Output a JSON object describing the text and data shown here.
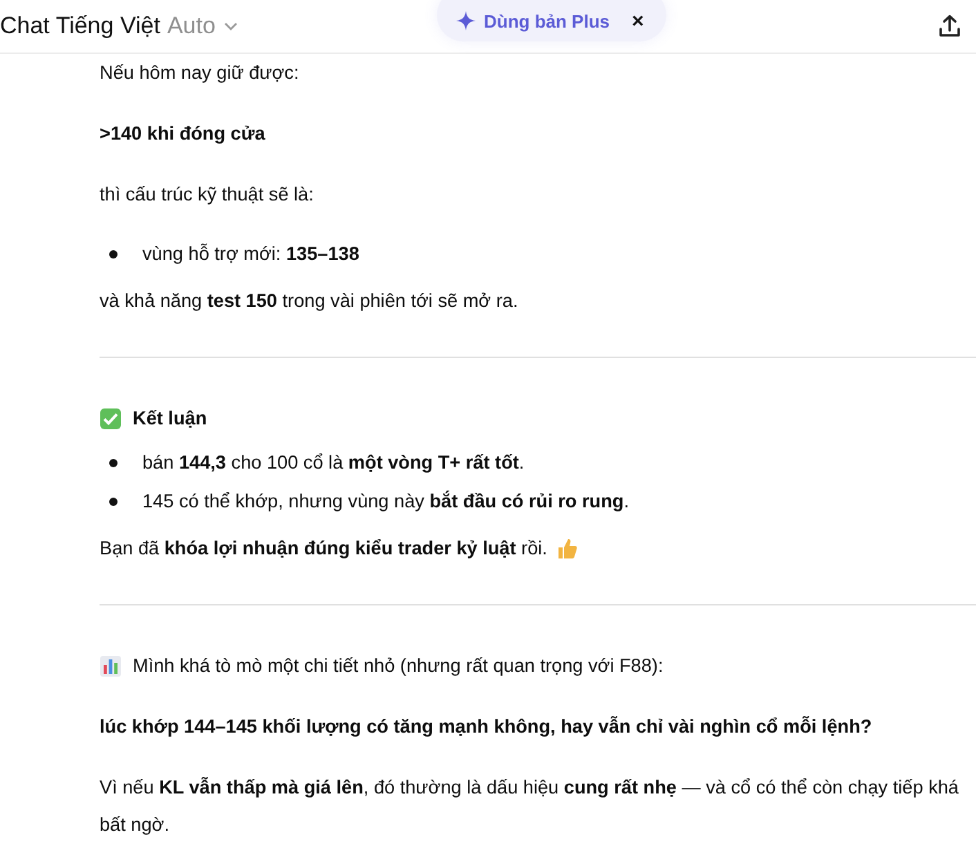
{
  "header": {
    "title": "Chat Tiếng Việt",
    "model": "Auto",
    "upgrade": {
      "label": "Dùng bản Plus",
      "close": "×"
    }
  },
  "blocks": [
    {
      "kind": "paragraph",
      "text": "Nếu hôm nay giữ được:"
    },
    {
      "kind": "paragraph",
      "text": "**>140 khi đóng cửa**"
    },
    {
      "kind": "paragraph",
      "text": "thì cấu trúc kỹ thuật sẽ là:"
    },
    {
      "kind": "list",
      "items": [
        "vùng hỗ trợ mới: **135–138**"
      ]
    },
    {
      "kind": "paragraph",
      "text": "và khả năng **test 150** trong vài phiên tới sẽ mở ra."
    },
    {
      "kind": "divider"
    },
    {
      "kind": "heading",
      "text": "Kết luận"
    },
    {
      "kind": "list",
      "items": [
        "bán **144,3** cho 100 cổ là **một vòng T+ rất tốt**.",
        "145 có thể khớp, nhưng vùng này **bắt đầu có rủi ro rung**."
      ]
    },
    {
      "kind": "closing",
      "text": "Bạn đã **khóa lợi nhuận đúng kiểu trader kỷ luật** rồi."
    },
    {
      "kind": "divider"
    },
    {
      "kind": "note",
      "text": "Mình khá tò mò một chi tiết nhỏ (nhưng rất quan trọng với F88):"
    },
    {
      "kind": "paragraph",
      "text": "**lúc khớp 144–145 khối lượng có tăng mạnh không, hay vẫn chỉ vài nghìn cổ mỗi lệnh?**"
    },
    {
      "kind": "paragraph",
      "text": "Vì nếu **KL vẫn thấp mà giá lên**, đó thường là dấu hiệu **cung rất nhẹ** — và cổ có thể còn chạy tiếp khá bất ngờ."
    }
  ]
}
